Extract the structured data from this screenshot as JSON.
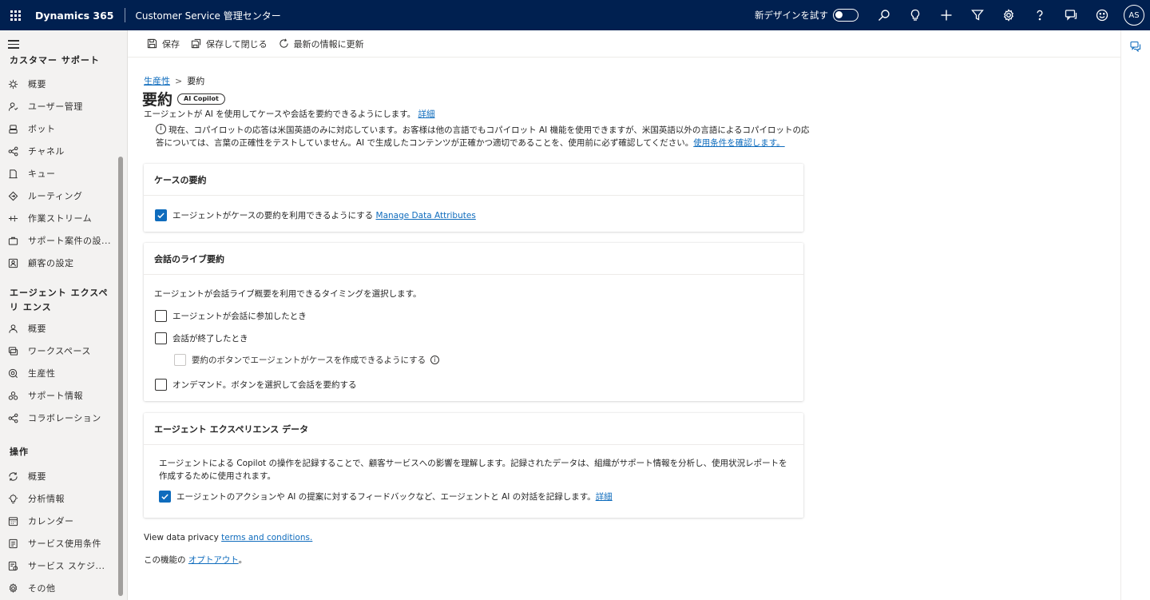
{
  "topbar": {
    "brand": "Dynamics 365",
    "app_name": "Customer Service 管理センター",
    "new_design_label": "新デザインを試す",
    "avatar_initials": "AS"
  },
  "sidebar": {
    "sections": [
      {
        "title": "カスタマー サポート",
        "items": [
          "概要",
          "ユーザー管理",
          "ボット",
          "チャネル",
          "キュー",
          "ルーティング",
          "作業ストリーム",
          "サポート案件の設...",
          "顧客の設定"
        ]
      },
      {
        "title": "エージェント エクスペリ エンス",
        "items": [
          "概要",
          "ワークスペース",
          "生産性",
          "サポート情報",
          "コラボレーション"
        ]
      },
      {
        "title": "操作",
        "items": [
          "概要",
          "分析情報",
          "カレンダー",
          "サービス使用条件",
          "サービス スケジ...",
          "その他"
        ]
      }
    ]
  },
  "commands": {
    "save": "保存",
    "save_close": "保存して閉じる",
    "refresh": "最新の情報に更新"
  },
  "breadcrumb": {
    "parent": "生産性",
    "current": "要約"
  },
  "page": {
    "title": "要約",
    "badge": "AI Copilot",
    "subtitle": "エージェントが AI を使用してケースや会話を要約できるようにします。",
    "subtitle_link": "詳細",
    "notice": "現在、コパイロットの応答は米国英語のみに対応しています。お客様は他の言語でもコパイロット AI 機能を使用できますが、米国英語以外の言語によるコパイロットの応答については、言葉の正確性をテストしていません。AI で生成したコンテンツが正確かつ適切であることを、使用前に必ず確認してください。",
    "notice_link": "使用条件を確認します。"
  },
  "case_summary": {
    "title": "ケースの要約",
    "checkbox_label": "エージェントがケースの要約を利用できるようにする",
    "checkbox_link": "Manage Data Attributes",
    "checked": true
  },
  "live_summary": {
    "title": "会話のライブ要約",
    "description": "エージェントが会話ライブ概要を利用できるタイミングを選択します。",
    "options": [
      {
        "label": "エージェントが会話に参加したとき",
        "checked": false
      },
      {
        "label": "会話が終了したとき",
        "checked": false
      },
      {
        "label": "要約のボタンでエージェントがケースを作成できるようにする",
        "checked": false
      },
      {
        "label": "オンデマンド。ボタンを選択して会話を要約する",
        "checked": false
      }
    ]
  },
  "agent_data": {
    "title": "エージェント エクスペリエンス データ",
    "description": "エージェントによる Copilot の操作を記録することで、顧客サービスへの影響を理解します。記録されたデータは、組織がサポート情報を分析し、使用状況レポートを作成するために使用されます。",
    "checkbox_label": "エージェントのアクションや AI の提案に対するフィードバックなど、エージェントと AI の対話を記録します。",
    "checkbox_link": "詳細",
    "checked": true
  },
  "footer": {
    "privacy_prefix": "View data privacy ",
    "privacy_link": "terms and conditions.",
    "optout_prefix": "この機能の ",
    "optout_link": "オプトアウト",
    "optout_suffix": "。"
  }
}
